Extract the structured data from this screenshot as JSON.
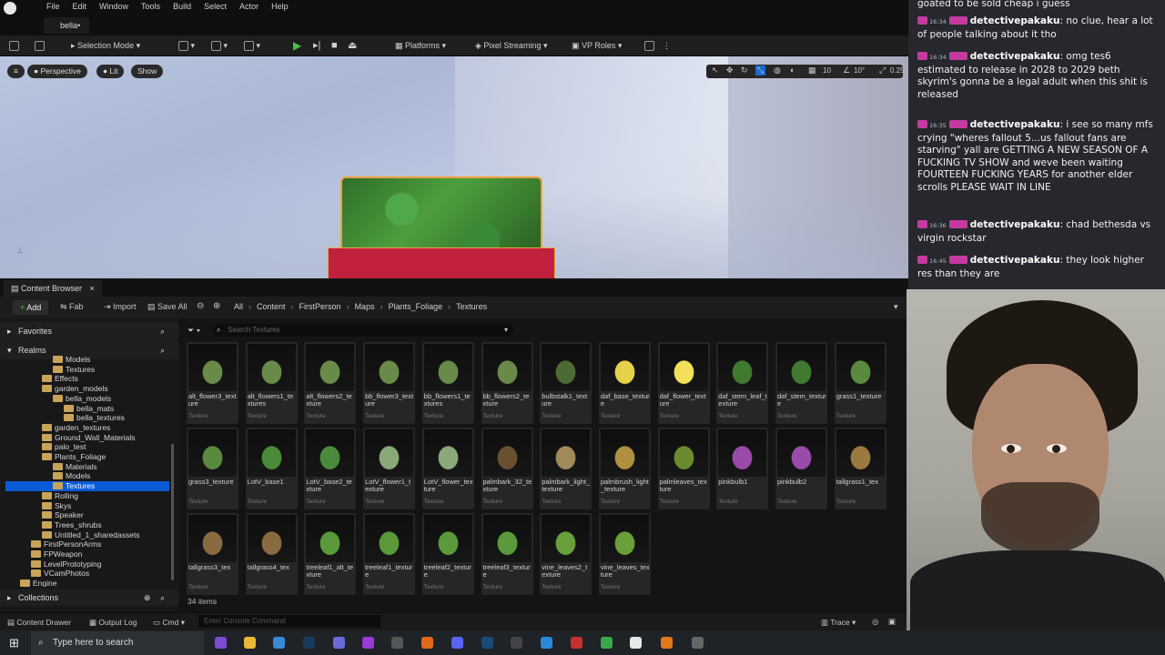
{
  "menu": {
    "items": [
      "File",
      "Edit",
      "Window",
      "Tools",
      "Build",
      "Select",
      "Actor",
      "Help"
    ],
    "tab": "bella•"
  },
  "toolbar": {
    "selection_mode": "Selection Mode",
    "platforms": "Platforms",
    "pixel_streaming": "Pixel Streaming",
    "vp_roles": "VP Roles"
  },
  "viewport": {
    "perspective": "Perspective",
    "lit": "Lit",
    "show": "Show",
    "grid": "10",
    "angle": "10°",
    "scale": "0.25"
  },
  "content_browser": {
    "tab": "Content Browser",
    "add": "Add",
    "fab": "Fab",
    "import": "Import",
    "save_all": "Save All",
    "breadcrumbs": [
      "All",
      "Content",
      "FirstPerson",
      "Maps",
      "Plants_Foliage",
      "Textures"
    ],
    "search_placeholder": "Search Textures",
    "favorites": "Favorites",
    "realms": "Realms",
    "collections": "Collections",
    "item_count": "34 items",
    "tree": [
      {
        "label": "Models",
        "depth": 4
      },
      {
        "label": "Textures",
        "depth": 4
      },
      {
        "label": "Effects",
        "depth": 3
      },
      {
        "label": "garden_models",
        "depth": 3
      },
      {
        "label": "bella_models",
        "depth": 4
      },
      {
        "label": "bella_mats",
        "depth": 5
      },
      {
        "label": "bella_textures",
        "depth": 5
      },
      {
        "label": "garden_textures",
        "depth": 3
      },
      {
        "label": "Ground_Wall_Materials",
        "depth": 3
      },
      {
        "label": "palo_test",
        "depth": 3
      },
      {
        "label": "Plants_Foliage",
        "depth": 3
      },
      {
        "label": "Materials",
        "depth": 4
      },
      {
        "label": "Models",
        "depth": 4
      },
      {
        "label": "Textures",
        "depth": 4,
        "selected": true
      },
      {
        "label": "Rolling",
        "depth": 3
      },
      {
        "label": "Skys",
        "depth": 3
      },
      {
        "label": "Speaker",
        "depth": 3
      },
      {
        "label": "Trees_shrubs",
        "depth": 3
      },
      {
        "label": "Untitled_1_sharedassets",
        "depth": 3
      },
      {
        "label": "FirstPersonArms",
        "depth": 2
      },
      {
        "label": "FPWeapon",
        "depth": 2
      },
      {
        "label": "LevelPrototyping",
        "depth": 2
      },
      {
        "label": "VCamPhotos",
        "depth": 2
      },
      {
        "label": "Engine",
        "depth": 1
      }
    ],
    "assets": [
      {
        "name": "alt_flower3_texture",
        "type": "Texture",
        "color": "#6a8a4a"
      },
      {
        "name": "alt_flowers1_textures",
        "type": "Texture",
        "color": "#6a8a4a"
      },
      {
        "name": "alt_flowers2_texture",
        "type": "Texture",
        "color": "#6a8a4a"
      },
      {
        "name": "bb_flower3_texture",
        "type": "Texture",
        "color": "#6a8a4a"
      },
      {
        "name": "bb_flowers1_textures",
        "type": "Texture",
        "color": "#6a8a4a"
      },
      {
        "name": "bb_flowers2_texture",
        "type": "Texture",
        "color": "#6a8a4a"
      },
      {
        "name": "bulbstalk1_texture",
        "type": "Texture",
        "color": "#4d6a34"
      },
      {
        "name": "daf_base_texture",
        "type": "Texture",
        "color": "#e6d24a"
      },
      {
        "name": "daf_flower_texture",
        "type": "Texture",
        "color": "#f2e05a"
      },
      {
        "name": "daf_stem_leaf_texture",
        "type": "Texture",
        "color": "#3f7a30"
      },
      {
        "name": "daf_stem_texture",
        "type": "Texture",
        "color": "#3f7a30"
      },
      {
        "name": "grass1_texture",
        "type": "Texture",
        "color": "#5a8a3e"
      },
      {
        "name": "grass3_texture",
        "type": "Texture",
        "color": "#5a8a3e"
      },
      {
        "name": "LotV_base1",
        "type": "Texture",
        "color": "#4a8a3a"
      },
      {
        "name": "LotV_base2_texture",
        "type": "Texture",
        "color": "#4a8a3a"
      },
      {
        "name": "LotV_flower1_texture",
        "type": "Texture",
        "color": "#8aa878"
      },
      {
        "name": "LotV_flower_texture",
        "type": "Texture",
        "color": "#8aa878"
      },
      {
        "name": "palmbark_32_texture",
        "type": "Texture",
        "color": "#6a5030"
      },
      {
        "name": "palmbark_light_texture",
        "type": "Texture",
        "color": "#a08a5a"
      },
      {
        "name": "palmbrush_light_texture",
        "type": "Texture",
        "color": "#b09040"
      },
      {
        "name": "palmleaves_texture",
        "type": "Texture",
        "color": "#6a8a30"
      },
      {
        "name": "pinkbulb1",
        "type": "Texture",
        "color": "#9a4aa8"
      },
      {
        "name": "pinkbulb2",
        "type": "Texture",
        "color": "#9a4aa8"
      },
      {
        "name": "tallgrass1_tex",
        "type": "Texture",
        "color": "#9a7a40"
      },
      {
        "name": "tallgrass3_tex",
        "type": "Texture",
        "color": "#8a6a40"
      },
      {
        "name": "tallgrass4_tex",
        "type": "Texture",
        "color": "#8a6a40"
      },
      {
        "name": "treeleaf1_alt_texture",
        "type": "Texture",
        "color": "#5a9a3a"
      },
      {
        "name": "treeleaf1_texture",
        "type": "Texture",
        "color": "#5a9a3a"
      },
      {
        "name": "treeleaf2_texture",
        "type": "Texture",
        "color": "#5a9a3a"
      },
      {
        "name": "treeleaf3_texture",
        "type": "Texture",
        "color": "#5a9a3a"
      },
      {
        "name": "vine_leaves2_texture",
        "type": "Texture",
        "color": "#6aa03a"
      },
      {
        "name": "vine_leaves_texture",
        "type": "Texture",
        "color": "#6aa03a"
      }
    ]
  },
  "status": {
    "content_drawer": "Content Drawer",
    "output_log": "Output Log",
    "cmd": "Cmd",
    "console_placeholder": "Enter Console Command",
    "trace": "Trace"
  },
  "taskbar": {
    "search": "Type here to search"
  },
  "chat": {
    "top_line": "goated to be sold cheap i guess",
    "messages": [
      {
        "time": "16:34",
        "user": "detectivepakaku",
        "text": "no clue, hear a lot of people talking about it tho"
      },
      {
        "time": "16:34",
        "user": "detectivepakaku",
        "text": "omg tes6 estimated to release in 2028 to 2029 beth skyrim's gonna be a legal adult when this shit is released"
      },
      {
        "time": "16:35",
        "user": "detectivepakaku",
        "text": "i see so many mfs crying \"wheres fallout 5...us fallout fans are starving\" yall are GETTING A NEW SEASON OF A FUCKING TV SHOW and weve been waiting FOURTEEN FUCKING YEARS for another elder scrolls PLEASE WAIT IN LINE"
      },
      {
        "time": "16:36",
        "user": "detectivepakaku",
        "text": "chad bethesda vs virgin rockstar"
      },
      {
        "time": "16:45",
        "user": "detectivepakaku",
        "text": "they look higher res than they are"
      }
    ]
  }
}
